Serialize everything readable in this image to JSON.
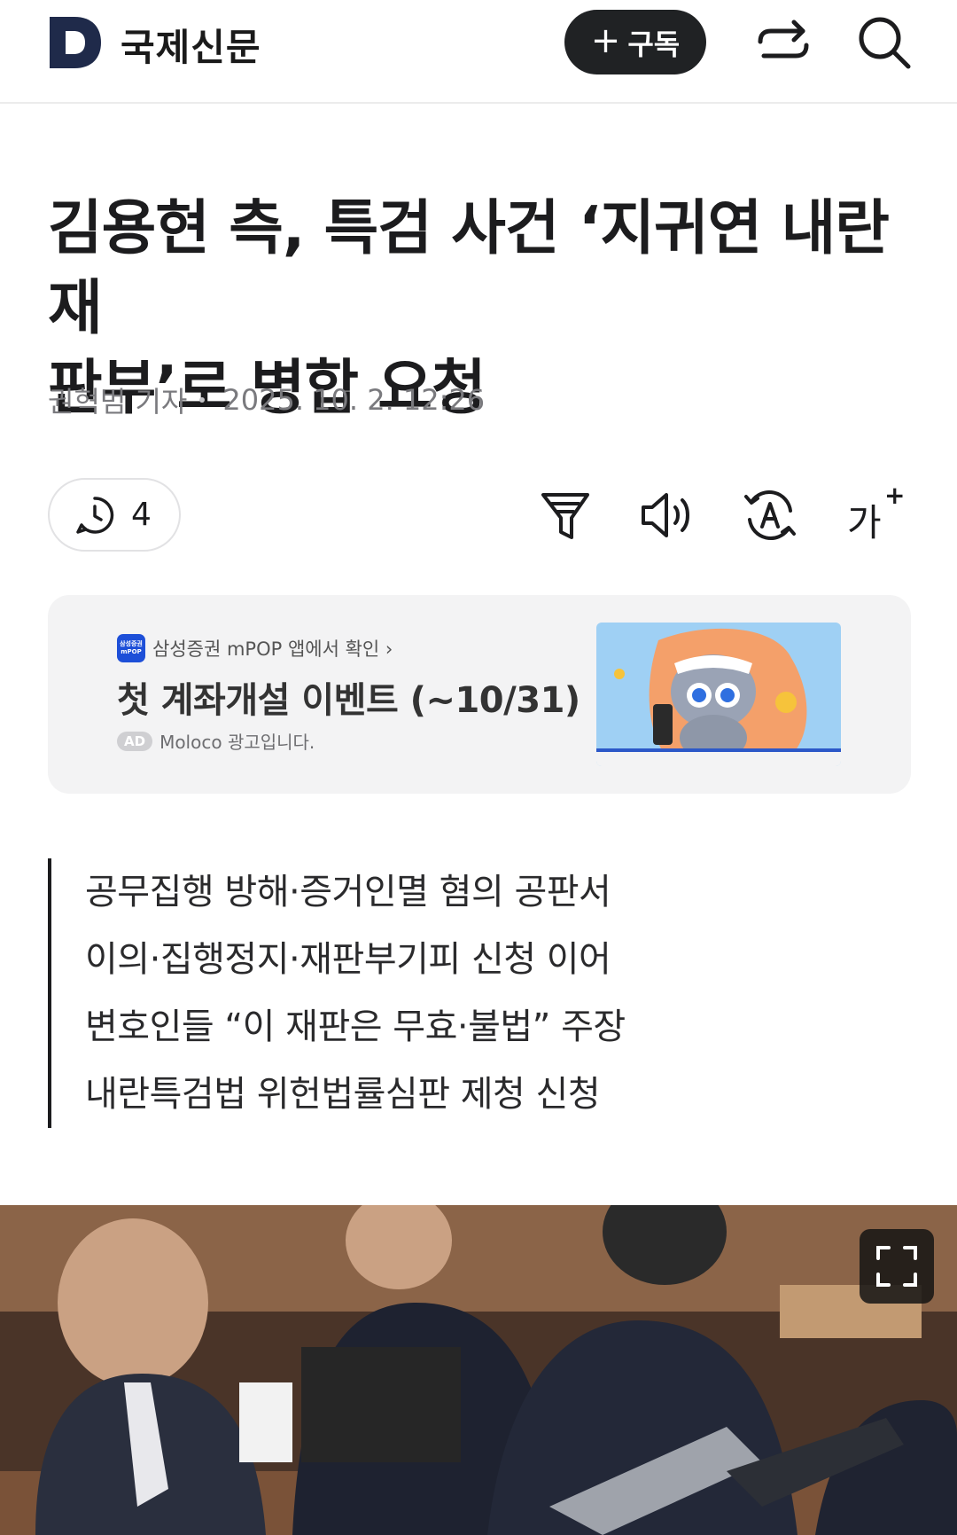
{
  "header": {
    "press_name": "국제신문",
    "logo_letter": "D",
    "subscribe_label": "구독",
    "share_icon": "share-icon",
    "search_icon": "search-icon"
  },
  "article": {
    "title_line1": "김용현 측, 특검 사건 ‘지귀연 내란재",
    "title_line2": "판부’로 병합 요청",
    "author": "권혁범 기자",
    "datetime": "2025. 10. 2. 12:26",
    "comment_count": "4",
    "tools": [
      "summary-icon",
      "audio-icon",
      "translate-icon",
      "font-size-icon"
    ],
    "font_size_label": "가",
    "summary_lines": [
      "공무집행 방해·증거인멸 혐의 공판서",
      "이의·집행정지·재판부기피 신청 이어",
      "변호인들 “이 재판은 무효·불법” 주장",
      "내란특검법 위헌법률심판 제청 신청"
    ]
  },
  "ad": {
    "app_icon_line1": "삼성증권",
    "app_icon_line2": "mPOP",
    "source": "삼성증권 mPOP 앱에서 확인 ›",
    "headline": "첫 계좌개설 이벤트 (~10/31)",
    "badge": "AD",
    "label": "Moloco 광고입니다."
  },
  "colors": {
    "accent_dark": "#202224",
    "logo_navy": "#1f2a4a",
    "ad_bg": "#f3f3f4",
    "ad_image_bg": "#9fd0f4"
  }
}
